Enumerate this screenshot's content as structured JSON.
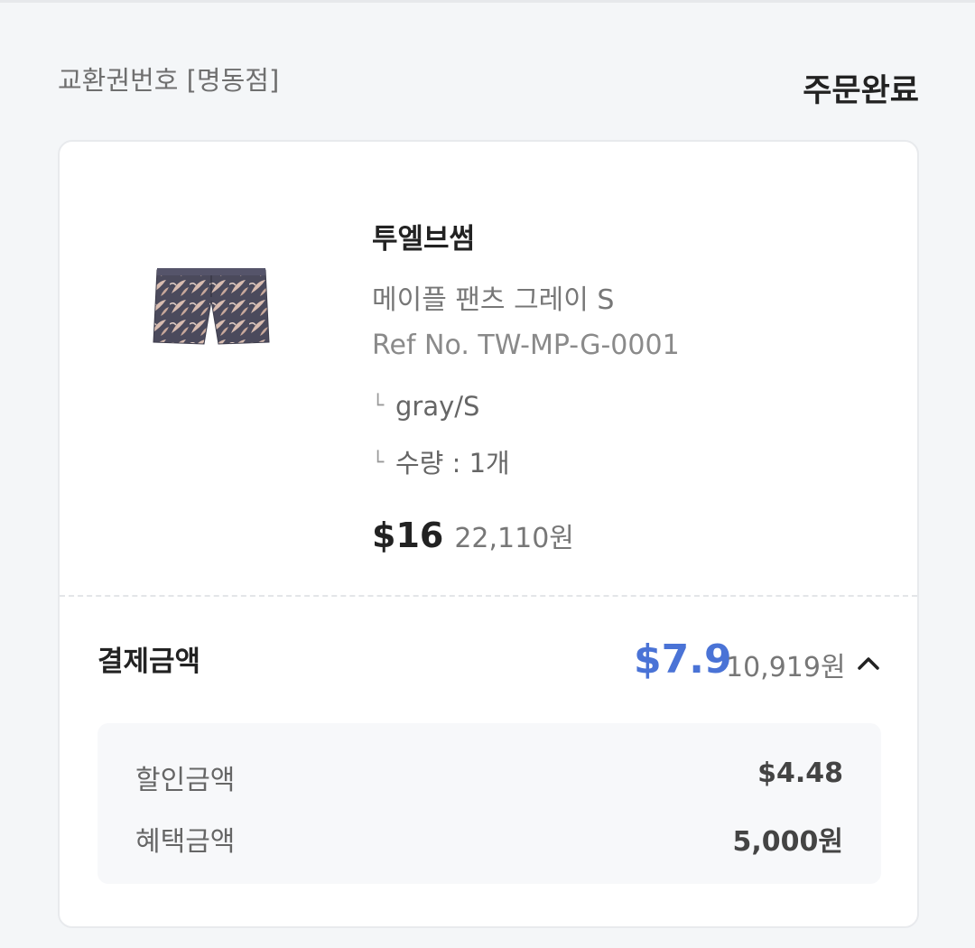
{
  "header": {
    "voucher_label": "교환권번호 [명동점]",
    "status": "주문완료"
  },
  "product": {
    "brand": "투엘브썸",
    "name": "메이플 팬츠 그레이 S",
    "ref": "Ref No. TW-MP-G-0001",
    "option": "gray/S",
    "quantity": "수량 : 1개",
    "price_usd": "$16",
    "price_krw": "22,110원",
    "thumbnail_icon": "patterned-shorts-image"
  },
  "payment": {
    "label": "결제금액",
    "amount_usd": "$7.9",
    "amount_krw": "10,919원",
    "accent_color": "#4a73d6",
    "toggle_icon": "chevron-up-icon",
    "details": [
      {
        "label": "할인금액",
        "value": "$4.48"
      },
      {
        "label": "혜택금액",
        "value": "5,000원"
      }
    ]
  }
}
